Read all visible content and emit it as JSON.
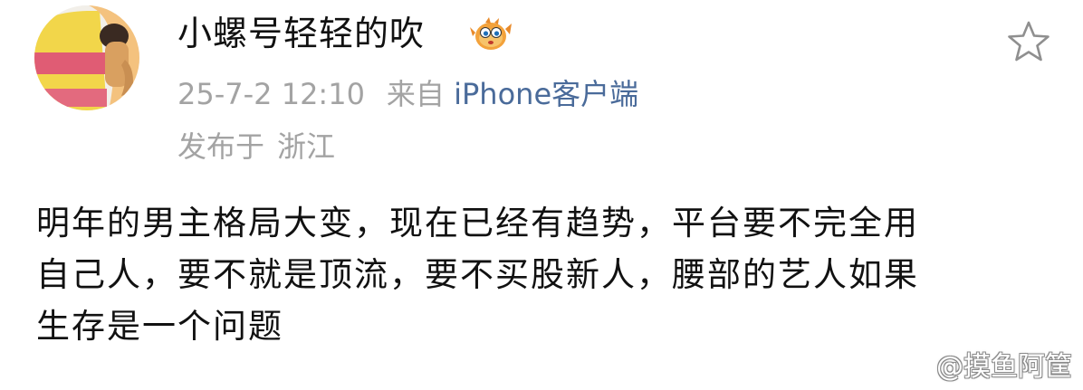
{
  "post": {
    "user_name": "小螺号轻轻的吹",
    "badge_icon": "pufferfish-icon",
    "favorite_icon": "star-outline-icon",
    "date_time": "25-7-2 12:10",
    "source_prefix": "来自",
    "source_client": "iPhone客户端",
    "location_prefix": "发布于",
    "location": "浙江",
    "content_lines": [
      "明年的男主格局大变，现在已经有趋势，平台要不完全用",
      "自己人，要不就是顶流，要不买股新人，腰部的艺人如果",
      "生存是一个问题"
    ]
  },
  "watermark": {
    "text": "@摸鱼阿筐"
  },
  "colors": {
    "text_primary": "#111111",
    "text_meta": "#a3a3a3",
    "link": "#4a6b9a",
    "background": "#ffffff"
  }
}
